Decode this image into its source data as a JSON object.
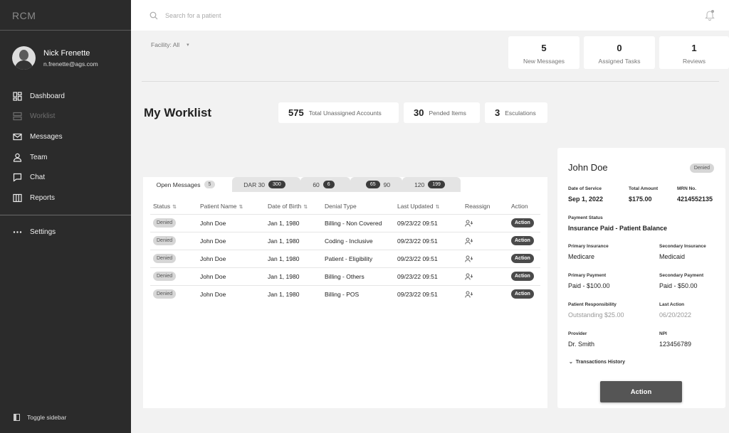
{
  "brand": "RCM",
  "user": {
    "name": "Nick Frenette",
    "email": "n.frenette@ags.com"
  },
  "nav": [
    {
      "label": "Dashboard",
      "icon": "dashboard-icon"
    },
    {
      "label": "Worklist",
      "icon": "worklist-icon"
    },
    {
      "label": "Messages",
      "icon": "messages-icon"
    },
    {
      "label": "Team",
      "icon": "team-icon"
    },
    {
      "label": "Chat",
      "icon": "chat-icon"
    },
    {
      "label": "Reports",
      "icon": "reports-icon"
    }
  ],
  "settings_label": "Settings",
  "toggle_label": "Toggle sidebar",
  "search": {
    "placeholder": "Search for a patient"
  },
  "facility": {
    "label": "Facility: All"
  },
  "top_stats": [
    {
      "value": "5",
      "label": "New Messages"
    },
    {
      "value": "0",
      "label": "Assigned Tasks"
    },
    {
      "value": "1",
      "label": "Reviews"
    }
  ],
  "page_title": "My Worklist",
  "summary": [
    {
      "value": "575",
      "label": "Total Unassigned Accounts"
    },
    {
      "value": "30",
      "label": "Pended Items"
    },
    {
      "value": "3",
      "label": "Esculations"
    }
  ],
  "tabs": [
    {
      "label": "Open Messages",
      "count": "5"
    },
    {
      "label": "DAR 30",
      "count": "300"
    },
    {
      "label": "60",
      "count": "6"
    },
    {
      "label": "90",
      "count": "65"
    },
    {
      "label": "120",
      "count": "199"
    }
  ],
  "table": {
    "headers": [
      "Status",
      "Patient Name",
      "Date of Birth",
      "Denial Type",
      "Last Updated",
      "Reassign",
      "Action"
    ],
    "rows": [
      {
        "status": "Denied",
        "name": "John Doe",
        "dob": "Jan 1, 1980",
        "denial": "Billing - Non Covered",
        "updated": "09/23/22 09:51",
        "action": "Action"
      },
      {
        "status": "Denied",
        "name": "John Doe",
        "dob": "Jan 1, 1980",
        "denial": "Coding - Inclusive",
        "updated": "09/23/22 09:51",
        "action": "Action"
      },
      {
        "status": "Denied",
        "name": "John Doe",
        "dob": "Jan 1, 1980",
        "denial": "Patient - Eligibility",
        "updated": "09/23/22 09:51",
        "action": "Action"
      },
      {
        "status": "Denied",
        "name": "John Doe",
        "dob": "Jan 1, 1980",
        "denial": "Billing - Others",
        "updated": "09/23/22 09:51",
        "action": "Action"
      },
      {
        "status": "Denied",
        "name": "John Doe",
        "dob": "Jan 1, 1980",
        "denial": "Billing - POS",
        "updated": "09/23/22 09:51",
        "action": "Action"
      }
    ]
  },
  "detail": {
    "name": "John Doe",
    "status": "Denied",
    "date_of_service_label": "Date of Service",
    "date_of_service": "Sep 1, 2022",
    "total_amount_label": "Total Amount",
    "total_amount": "$175.00",
    "mrn_label": "MRN No.",
    "mrn": "4214552135",
    "payment_status_label": "Payment Status",
    "payment_status": "Insurance Paid - Patient Balance",
    "primary_insurance_label": "Primary Insurance",
    "primary_insurance": "Medicare",
    "secondary_insurance_label": "Secondary Insurance",
    "secondary_insurance": "Medicaid",
    "primary_payment_label": "Primary Payment",
    "primary_payment": "Paid - $100.00",
    "secondary_payment_label": "Secondary Payment",
    "secondary_payment": "Paid - $50.00",
    "patient_responsibility_label": "Patient Responsibility",
    "patient_responsibility": "Outstanding $25.00",
    "last_action_label": "Last Action",
    "last_action": "06/20/2022",
    "provider_label": "Provider",
    "provider": "Dr. Smith",
    "npi_label": "NPI",
    "npi": "123456789",
    "transactions_label": "Transactions History",
    "action_label": "Action"
  }
}
